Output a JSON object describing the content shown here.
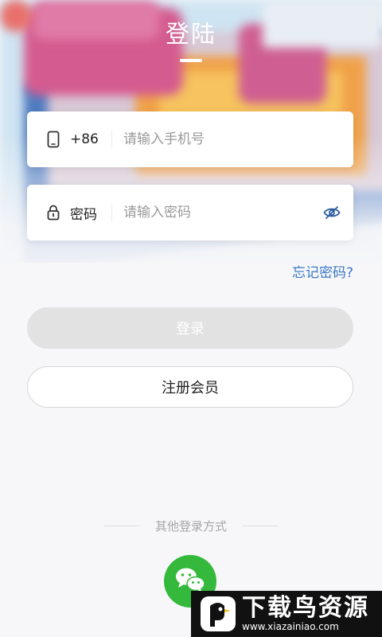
{
  "header": {
    "title": "登陆"
  },
  "phone_field": {
    "icon": "phone-icon",
    "country_code": "+86",
    "placeholder": "请输入手机号",
    "value": ""
  },
  "password_field": {
    "icon": "lock-icon",
    "label": "密码",
    "placeholder": "请输入密码",
    "value": "",
    "toggle_icon": "eye-slash-icon"
  },
  "links": {
    "forgot_password": "忘记密码?"
  },
  "buttons": {
    "login": "登录",
    "register": "注册会员"
  },
  "other_login": {
    "label": "其他登录方式",
    "methods": [
      {
        "icon": "wechat-icon",
        "color": "#35b93c"
      }
    ]
  },
  "watermark": {
    "brand": "下载鸟资源",
    "url": "www.xiazainiao.com"
  },
  "colors": {
    "accent_link": "#3a78c7",
    "login_disabled": "#e2e2e2",
    "wechat": "#35b93c"
  }
}
